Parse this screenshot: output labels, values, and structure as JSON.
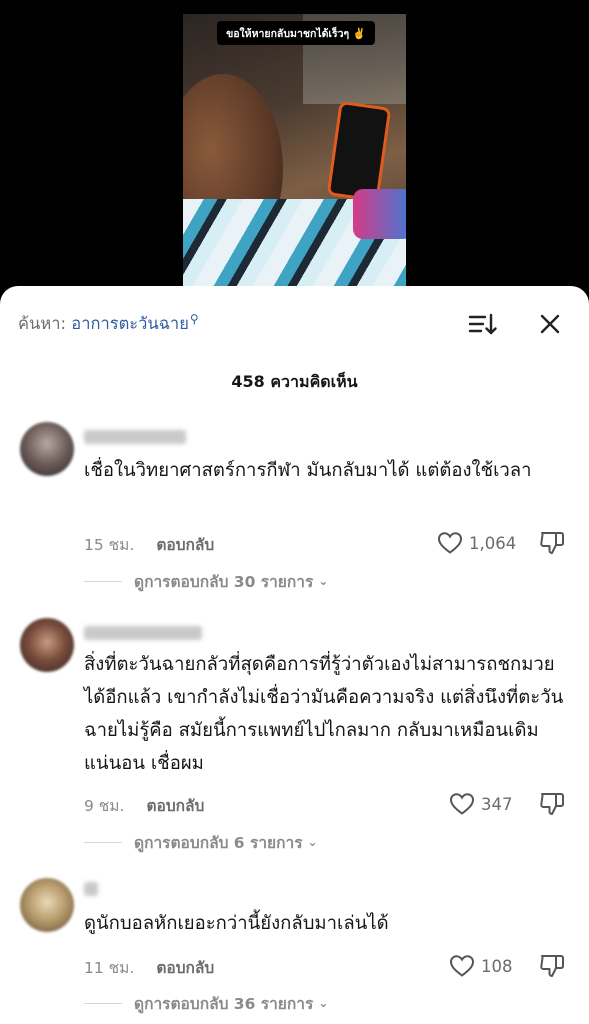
{
  "video": {
    "caption": "ขอให้หายกลับมาชกได้เร็วๆ ✌️"
  },
  "search": {
    "label": "ค้นหา:",
    "term": "อาการตะวันฉาย",
    "icon": "search-icon"
  },
  "header": {
    "comment_count": "458 ความคิดเห็น"
  },
  "comments": [
    {
      "text": "เชื่อในวิทยาศาสตร์การกีฬา มันกลับมาได้ แต่ต้องใช้เวลา",
      "time": "15 ชม.",
      "reply_label": "ตอบกลับ",
      "likes": "1,064",
      "view_replies": "ดูการตอบกลับ 30 รายการ"
    },
    {
      "text": "สิ่งที่ตะวันฉายกลัวที่สุดคือการที่รู้ว่าตัวเองไม่สามารถชกมวยได้อีกแล้ว เขากำลังไม่เชื่อว่ามันคือความจริง แต่สิ่งนึงที่ตะวันฉายไม่รู้คือ สมัยนี้การแพทย์ไปไกลมาก กลับมาเหมือนเดิมแน่นอน เชื่อผม",
      "time": "9 ชม.",
      "reply_label": "ตอบกลับ",
      "likes": "347",
      "view_replies": "ดูการตอบกลับ 6 รายการ"
    },
    {
      "text": "ดูนักบอลหักเยอะกว่านี้ยังกลับมาเล่นได้",
      "time": "11 ชม.",
      "reply_label": "ตอบกลับ",
      "likes": "108",
      "view_replies": "ดูการตอบกลับ 36 รายการ"
    }
  ],
  "colors": {
    "search_term": "#2f5fa3",
    "secondary_text": "#8a8a8a",
    "primary_text": "#161616"
  }
}
